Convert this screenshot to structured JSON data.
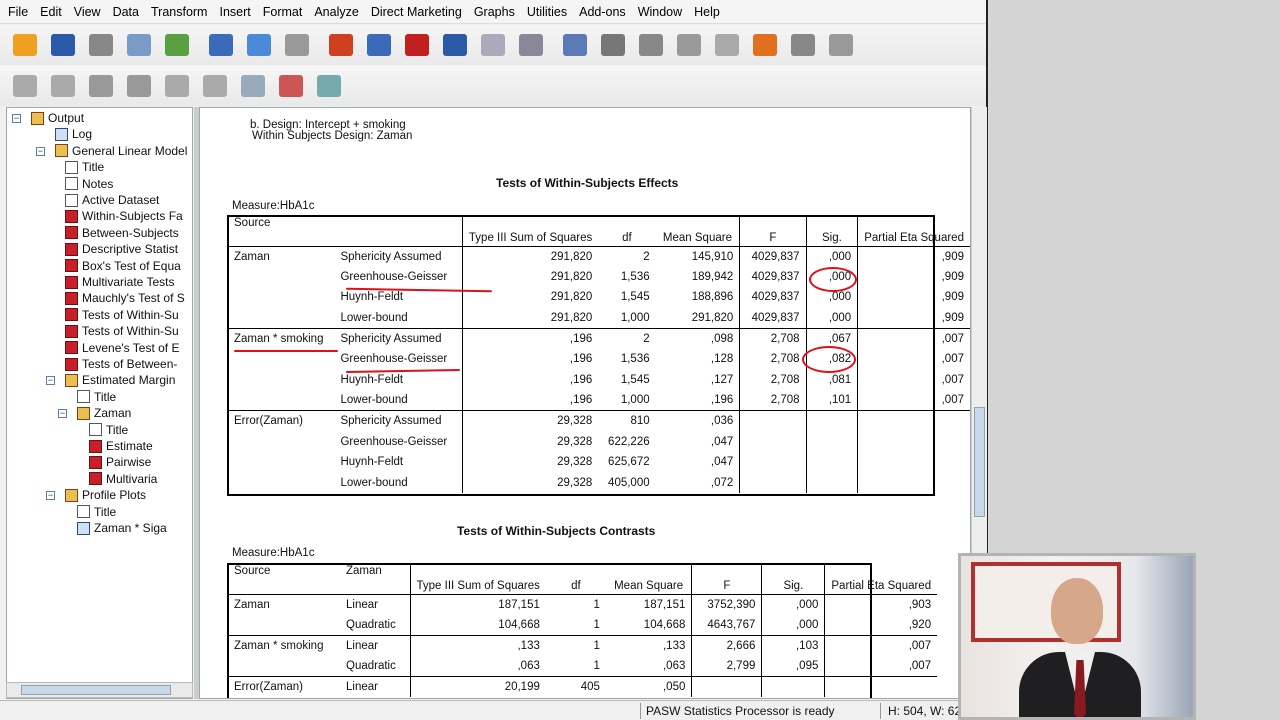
{
  "menu": [
    "File",
    "Edit",
    "View",
    "Data",
    "Transform",
    "Insert",
    "Format",
    "Analyze",
    "Direct Marketing",
    "Graphs",
    "Utilities",
    "Add-ons",
    "Window",
    "Help"
  ],
  "toolbar1_icons": [
    "open-icon",
    "save-icon",
    "print-icon",
    "print-preview-icon",
    "export-icon",
    "recall-dialog-icon",
    "undo-icon",
    "redo-icon",
    "goto-data-icon",
    "goto-case-icon",
    "goto-variable-icon",
    "variables-icon",
    "use-variable-sets-icon",
    "show-all-variables-icon",
    "spelling-icon",
    "designate-window-icon",
    "insert-output-icon",
    "insert-title-icon",
    "insert-text-icon",
    "insert-image-icon",
    "create-edit-autoscript-icon",
    "run-script-icon"
  ],
  "toolbar2_icons": [
    "back-icon",
    "forward-icon",
    "expand-icon",
    "collapse-icon",
    "show-icon",
    "hide-icon",
    "insert-heading-icon",
    "insert-new-title-icon",
    "insert-new-text-icon"
  ],
  "outline": [
    {
      "label": "Output",
      "icon": "book"
    },
    {
      "label": "Log",
      "icon": "log"
    },
    {
      "label": "General Linear Model",
      "icon": "book"
    },
    {
      "label": "Title",
      "icon": "page"
    },
    {
      "label": "Notes",
      "icon": "page"
    },
    {
      "label": "Active Dataset",
      "icon": "page"
    },
    {
      "label": "Within-Subjects Fa",
      "icon": "table"
    },
    {
      "label": "Between-Subjects",
      "icon": "table"
    },
    {
      "label": "Descriptive Statist",
      "icon": "table"
    },
    {
      "label": "Box's Test of Equa",
      "icon": "table"
    },
    {
      "label": "Multivariate Tests",
      "icon": "table"
    },
    {
      "label": "Mauchly's Test of S",
      "icon": "table"
    },
    {
      "label": "Tests of Within-Su",
      "icon": "table"
    },
    {
      "label": "Tests of Within-Su",
      "icon": "table"
    },
    {
      "label": "Levene's Test of E",
      "icon": "table"
    },
    {
      "label": "Tests of Between-",
      "icon": "table"
    },
    {
      "label": "Estimated Margin",
      "icon": "book"
    },
    {
      "label": "Title",
      "icon": "page"
    },
    {
      "label": "Zaman",
      "icon": "book"
    },
    {
      "label": "Title",
      "icon": "page"
    },
    {
      "label": "Estimate",
      "icon": "table"
    },
    {
      "label": "Pairwise",
      "icon": "table"
    },
    {
      "label": "Multivaria",
      "icon": "table"
    },
    {
      "label": "Profile Plots",
      "icon": "book"
    },
    {
      "label": "Title",
      "icon": "page"
    },
    {
      "label": "Zaman * Siga",
      "icon": "chart"
    }
  ],
  "content": {
    "footnote1": "b. Design: Intercept + smoking",
    "footnote2": "Within Subjects Design: Zaman",
    "effects": {
      "title": "Tests of Within-Subjects Effects",
      "measure": "Measure:HbA1c",
      "headers": [
        "Source",
        "",
        "Type III Sum of Squares",
        "df",
        "Mean Square",
        "F",
        "Sig.",
        "Partial Eta Squared"
      ],
      "rows": [
        [
          "Zaman",
          "Sphericity Assumed",
          "291,820",
          "2",
          "145,910",
          "4029,837",
          ",000",
          ",909"
        ],
        [
          "",
          "Greenhouse-Geisser",
          "291,820",
          "1,536",
          "189,942",
          "4029,837",
          ",000",
          ",909"
        ],
        [
          "",
          "Huynh-Feldt",
          "291,820",
          "1,545",
          "188,896",
          "4029,837",
          ",000",
          ",909"
        ],
        [
          "",
          "Lower-bound",
          "291,820",
          "1,000",
          "291,820",
          "4029,837",
          ",000",
          ",909"
        ],
        [
          "Zaman * smoking",
          "Sphericity Assumed",
          ",196",
          "2",
          ",098",
          "2,708",
          ",067",
          ",007"
        ],
        [
          "",
          "Greenhouse-Geisser",
          ",196",
          "1,536",
          ",128",
          "2,708",
          ",082",
          ",007"
        ],
        [
          "",
          "Huynh-Feldt",
          ",196",
          "1,545",
          ",127",
          "2,708",
          ",081",
          ",007"
        ],
        [
          "",
          "Lower-bound",
          ",196",
          "1,000",
          ",196",
          "2,708",
          ",101",
          ",007"
        ],
        [
          "Error(Zaman)",
          "Sphericity Assumed",
          "29,328",
          "810",
          ",036",
          "",
          "",
          ""
        ],
        [
          "",
          "Greenhouse-Geisser",
          "29,328",
          "622,226",
          ",047",
          "",
          "",
          ""
        ],
        [
          "",
          "Huynh-Feldt",
          "29,328",
          "625,672",
          ",047",
          "",
          "",
          ""
        ],
        [
          "",
          "Lower-bound",
          "29,328",
          "405,000",
          ",072",
          "",
          "",
          ""
        ]
      ]
    },
    "contrasts": {
      "title": "Tests of Within-Subjects Contrasts",
      "measure": "Measure:HbA1c",
      "headers": [
        "Source",
        "Zaman",
        "Type III Sum of Squares",
        "df",
        "Mean Square",
        "F",
        "Sig.",
        "Partial Eta Squared"
      ],
      "rows": [
        [
          "Zaman",
          "Linear",
          "187,151",
          "1",
          "187,151",
          "3752,390",
          ",000",
          ",903"
        ],
        [
          "",
          "Quadratic",
          "104,668",
          "1",
          "104,668",
          "4643,767",
          ",000",
          ",920"
        ],
        [
          "Zaman * smoking",
          "Linear",
          ",133",
          "1",
          ",133",
          "2,666",
          ",103",
          ",007"
        ],
        [
          "",
          "Quadratic",
          ",063",
          "1",
          ",063",
          "2,799",
          ",095",
          ",007"
        ],
        [
          "Error(Zaman)",
          "Linear",
          "20,199",
          "405",
          ",050",
          "",
          "",
          ""
        ]
      ]
    }
  },
  "status": {
    "processor": "PASW Statistics Processor is ready",
    "dims": "H: 504, W: 62"
  },
  "colors": {
    "annotation": "#e0101a",
    "selection": "#c8d8ea"
  }
}
